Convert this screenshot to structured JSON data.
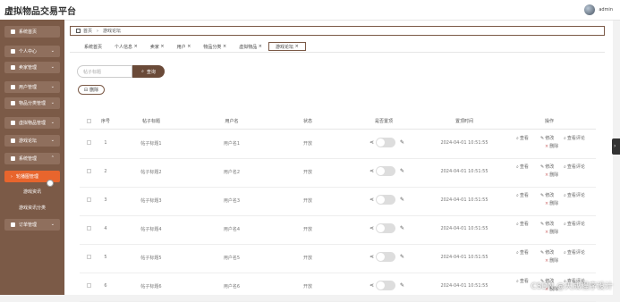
{
  "app": {
    "title": "虚拟物品交易平台",
    "user_name": "admin"
  },
  "sidebar": {
    "items": [
      {
        "label": "系统首页"
      },
      {
        "label": "个人中心"
      },
      {
        "label": "卖家管理"
      },
      {
        "label": "用户管理"
      },
      {
        "label": "物品分类管理"
      },
      {
        "label": "虚拟物品管理"
      },
      {
        "label": "游戏论坛"
      },
      {
        "label": "系统管理"
      },
      {
        "label": "轮播图管理"
      },
      {
        "label": "订单管理"
      }
    ],
    "sub_items": [
      {
        "label": "游戏资讯"
      },
      {
        "label": "游戏资讯分类"
      }
    ]
  },
  "breadcrumb": {
    "home": "首页",
    "current": "游戏论坛"
  },
  "tabs": [
    {
      "label": "系统首页"
    },
    {
      "label": "个人信息"
    },
    {
      "label": "卖家"
    },
    {
      "label": "用户"
    },
    {
      "label": "物品分类"
    },
    {
      "label": "虚拟物品"
    },
    {
      "label": "游戏论坛"
    }
  ],
  "search": {
    "placeholder": "帖子标题",
    "button_label": "查询"
  },
  "toolbar": {
    "delete_label": "删除"
  },
  "table": {
    "headers": [
      "序号",
      "帖子标题",
      "用户名",
      "状态",
      "是否置顶",
      "置顶时间",
      "操作"
    ],
    "rows": [
      {
        "index": "1",
        "title": "帖子标题1",
        "user": "用户名1",
        "status": "开放",
        "time": "2024-04-01 10:51:55"
      },
      {
        "index": "2",
        "title": "帖子标题2",
        "user": "用户名2",
        "status": "开放",
        "time": "2024-04-01 10:51:55"
      },
      {
        "index": "3",
        "title": "帖子标题3",
        "user": "用户名3",
        "status": "开放",
        "time": "2024-04-01 10:51:55"
      },
      {
        "index": "4",
        "title": "帖子标题4",
        "user": "用户名4",
        "status": "开放",
        "time": "2024-04-01 10:51:55"
      },
      {
        "index": "5",
        "title": "帖子标题5",
        "user": "用户名5",
        "status": "开放",
        "time": "2024-04-01 10:51:55"
      },
      {
        "index": "6",
        "title": "帖子标题6",
        "user": "用户名6",
        "status": "开放",
        "time": "2024-04-01 10:51:55"
      }
    ],
    "actions": {
      "view": "查看",
      "edit": "修改",
      "view_comments": "查看评论",
      "delete": "删除"
    }
  },
  "watermark": "CSDN @天成程序设计",
  "colors": {
    "sidebar_bg": "#7b5a47",
    "active_orange": "#e8652d",
    "button_brown": "#6a4a38"
  }
}
